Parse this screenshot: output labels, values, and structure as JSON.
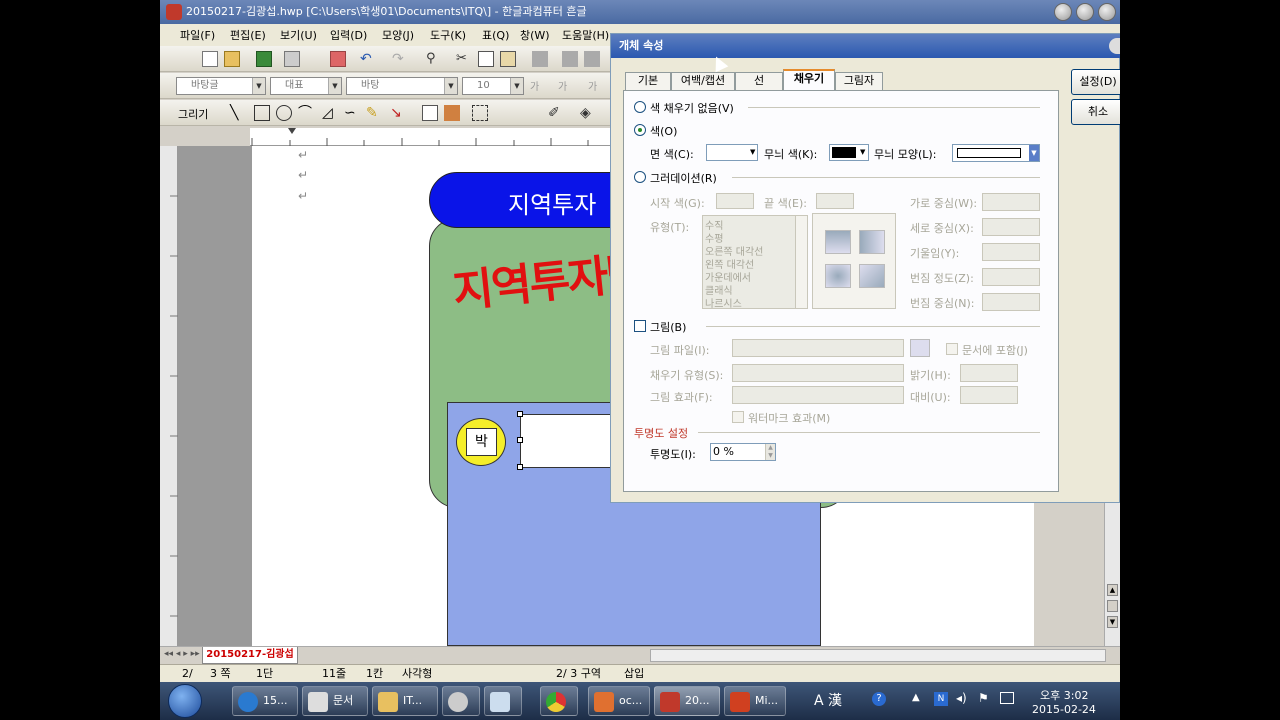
{
  "window": {
    "title": "20150217-김광섭.hwp [C:\\Users\\학생01\\Documents\\ITQ\\] - 한글과컴퓨터 흔글"
  },
  "menu": [
    "파일(F)",
    "편집(E)",
    "보기(U)",
    "입력(D)",
    "모양(J)",
    "도구(K)",
    "표(Q)",
    "창(W)",
    "도움말(H)"
  ],
  "toolbar": {
    "style_combo": "바탕글",
    "font_type_combo": "대표",
    "font_combo": "바탕",
    "size_combo": "10",
    "draw_label": "그리기"
  },
  "document": {
    "line_marks": [
      "↵",
      "↵",
      "↵"
    ],
    "banner_text": "지역투자",
    "wordart_text": "지역투자박람회",
    "circle_text": "박",
    "tab_name": "20150217-김광섭"
  },
  "dialog": {
    "title": "개체 속성",
    "tabs": [
      "기본",
      "여백/캡션",
      "선",
      "채우기",
      "그림자"
    ],
    "active_tab": "채우기",
    "ok_label": "설정(D)",
    "cancel_label": "취소",
    "no_fill_label": "색 채우기 없음(V)",
    "color_label": "색(O)",
    "face_color_label": "면 색(C):",
    "pattern_color_label": "무늬 색(K):",
    "pattern_shape_label": "무늬 모양(L):",
    "gradation_label": "그러데이션(R)",
    "start_color_label": "시작 색(G):",
    "end_color_label": "끝 색(E):",
    "type_label": "유형(T):",
    "gradation_types": [
      "수직",
      "수평",
      "오른쪽 대각선",
      "왼쪽 대각선",
      "가운데에서",
      "클래식",
      "나르시스"
    ],
    "h_center_label": "가로 중심(W):",
    "v_center_label": "세로 중심(X):",
    "tilt_label": "기울임(Y):",
    "blur_degree_label": "번짐 정도(Z):",
    "blur_center_label": "번짐 중심(N):",
    "picture_label": "그림(B)",
    "picture_file_label": "그림 파일(I):",
    "include_doc_label": "문서에 포함(J)",
    "fill_type_label": "채우기 유형(S):",
    "brightness_label": "밝기(H):",
    "picture_effect_label": "그림 효과(F):",
    "contrast_label": "대비(U):",
    "watermark_label": "워터마크 효과(M)",
    "transparency_section": "투명도 설정",
    "transparency_label": "투명도(I):",
    "transparency_value": "0 %"
  },
  "statusbar": {
    "page": "2/",
    "page_count": "3 쪽",
    "column": "1단",
    "line": "11줄",
    "col": "1칸",
    "object": "사각형",
    "section": "2/ 3 구역",
    "mode": "삽입"
  },
  "taskbar": {
    "items": [
      "15...",
      "문서",
      "IT...",
      "",
      "",
      "oc...",
      "20...",
      "Mi..."
    ],
    "clock_time": "오후 3:02",
    "clock_date": "2015-02-24"
  },
  "colors": {
    "banner_blue": "#0a14e8",
    "green_box": "#8dbd85",
    "lavender_box": "#8fa5e8",
    "wordart_red": "#e11010",
    "circle_yellow": "#f5ee2a"
  }
}
